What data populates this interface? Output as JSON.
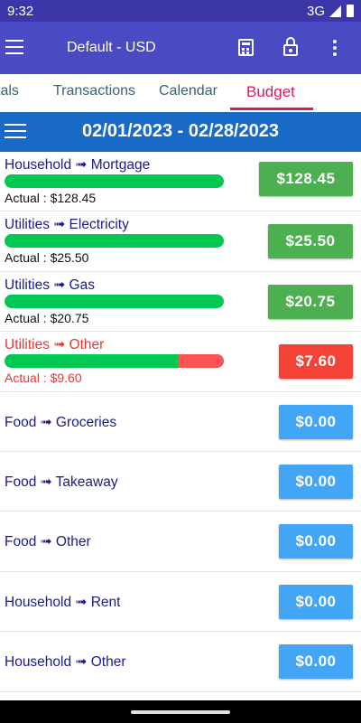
{
  "status_bar": {
    "time": "9:32",
    "network": "3G"
  },
  "app_bar": {
    "title": "Default - USD"
  },
  "tabs": [
    {
      "label": "tals",
      "active": false
    },
    {
      "label": "Transactions",
      "active": false
    },
    {
      "label": "Calendar",
      "active": false
    },
    {
      "label": "Budget",
      "active": true
    }
  ],
  "period": {
    "range": "02/01/2023 - 02/28/2023"
  },
  "colors": {
    "accent": "#d81b60",
    "app_bar": "#4a4ac4",
    "period_bar": "#1969c6",
    "progress_ok": "#00c853",
    "progress_over": "#ff5252",
    "amount_ok": "#4caf50",
    "amount_over": "#f44336",
    "amount_zero": "#42a5f5"
  },
  "budget_rows": [
    {
      "category": "Household ➟ Mortgage",
      "actual": "Actual : $128.45",
      "amount": "$128.45",
      "progress": 1.0,
      "over": 0
    },
    {
      "category": "Utilities ➟ Electricity",
      "actual": "Actual : $25.50",
      "amount": "$25.50",
      "progress": 1.0,
      "over": 0
    },
    {
      "category": "Utilities ➟ Gas",
      "actual": "Actual : $20.75",
      "amount": "$20.75",
      "progress": 1.0,
      "over": 0
    },
    {
      "category": "Utilities ➟ Other",
      "actual": "Actual : $9.60",
      "amount": "$7.60",
      "progress": 1.0,
      "over": 0.21
    },
    {
      "category": "Food ➟ Groceries",
      "amount": "$0.00"
    },
    {
      "category": "Food ➟ Takeaway",
      "amount": "$0.00"
    },
    {
      "category": "Food ➟ Other",
      "amount": "$0.00"
    },
    {
      "category": "Household ➟ Rent",
      "amount": "$0.00"
    },
    {
      "category": "Household ➟ Other",
      "amount": "$0.00"
    }
  ]
}
